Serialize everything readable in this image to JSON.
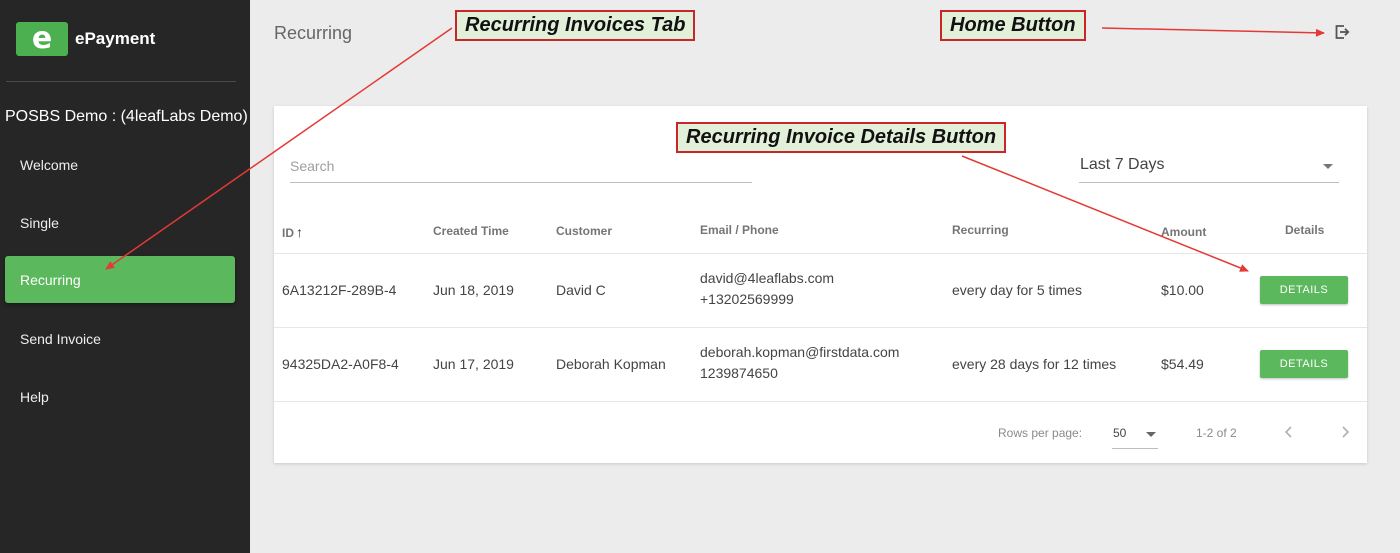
{
  "app": {
    "logo_letter": "e",
    "name": "ePayment",
    "merchant": "POSBS Demo : (4leafLabs Demo)",
    "brand_color": "#5cb85c"
  },
  "sidebar": {
    "items": [
      {
        "label": "Welcome",
        "active": false
      },
      {
        "label": "Single",
        "active": false
      },
      {
        "label": "Recurring",
        "active": true
      },
      {
        "label": "Send Invoice",
        "active": false
      },
      {
        "label": "Help",
        "active": false
      }
    ]
  },
  "header": {
    "title": "Recurring",
    "home_icon": "logout-icon"
  },
  "filters": {
    "search_placeholder": "Search",
    "search_value": "",
    "date_range": "Last 7 Days"
  },
  "table": {
    "columns": [
      "ID",
      "Created Time",
      "Customer",
      "Email / Phone",
      "Recurring",
      "Amount",
      "Details"
    ],
    "sort_indicator": "↑",
    "rows": [
      {
        "id": "6A13212F-289B-4",
        "created": "Jun 18, 2019",
        "customer": "David C",
        "email": "david@4leaflabs.com",
        "phone": "+13202569999",
        "recurring": "every day for 5 times",
        "amount": "$10.00",
        "details_label": "DETAILS"
      },
      {
        "id": "94325DA2-A0F8-4",
        "created": "Jun 17, 2019",
        "customer": "Deborah Kopman",
        "email": "deborah.kopman@firstdata.com",
        "phone": "1239874650",
        "recurring": "every 28 days for 12 times",
        "amount": "$54.49",
        "details_label": "DETAILS"
      }
    ]
  },
  "pagination": {
    "rows_per_page_label": "Rows per page:",
    "rows_per_page": "50",
    "range": "1-2 of 2"
  },
  "annotations": {
    "recurring_tab": "Recurring Invoices Tab",
    "home_button": "Home Button",
    "details_button": "Recurring Invoice Details Button",
    "callout_bg": "#e2efd9",
    "arrow_color": "#e53935"
  }
}
